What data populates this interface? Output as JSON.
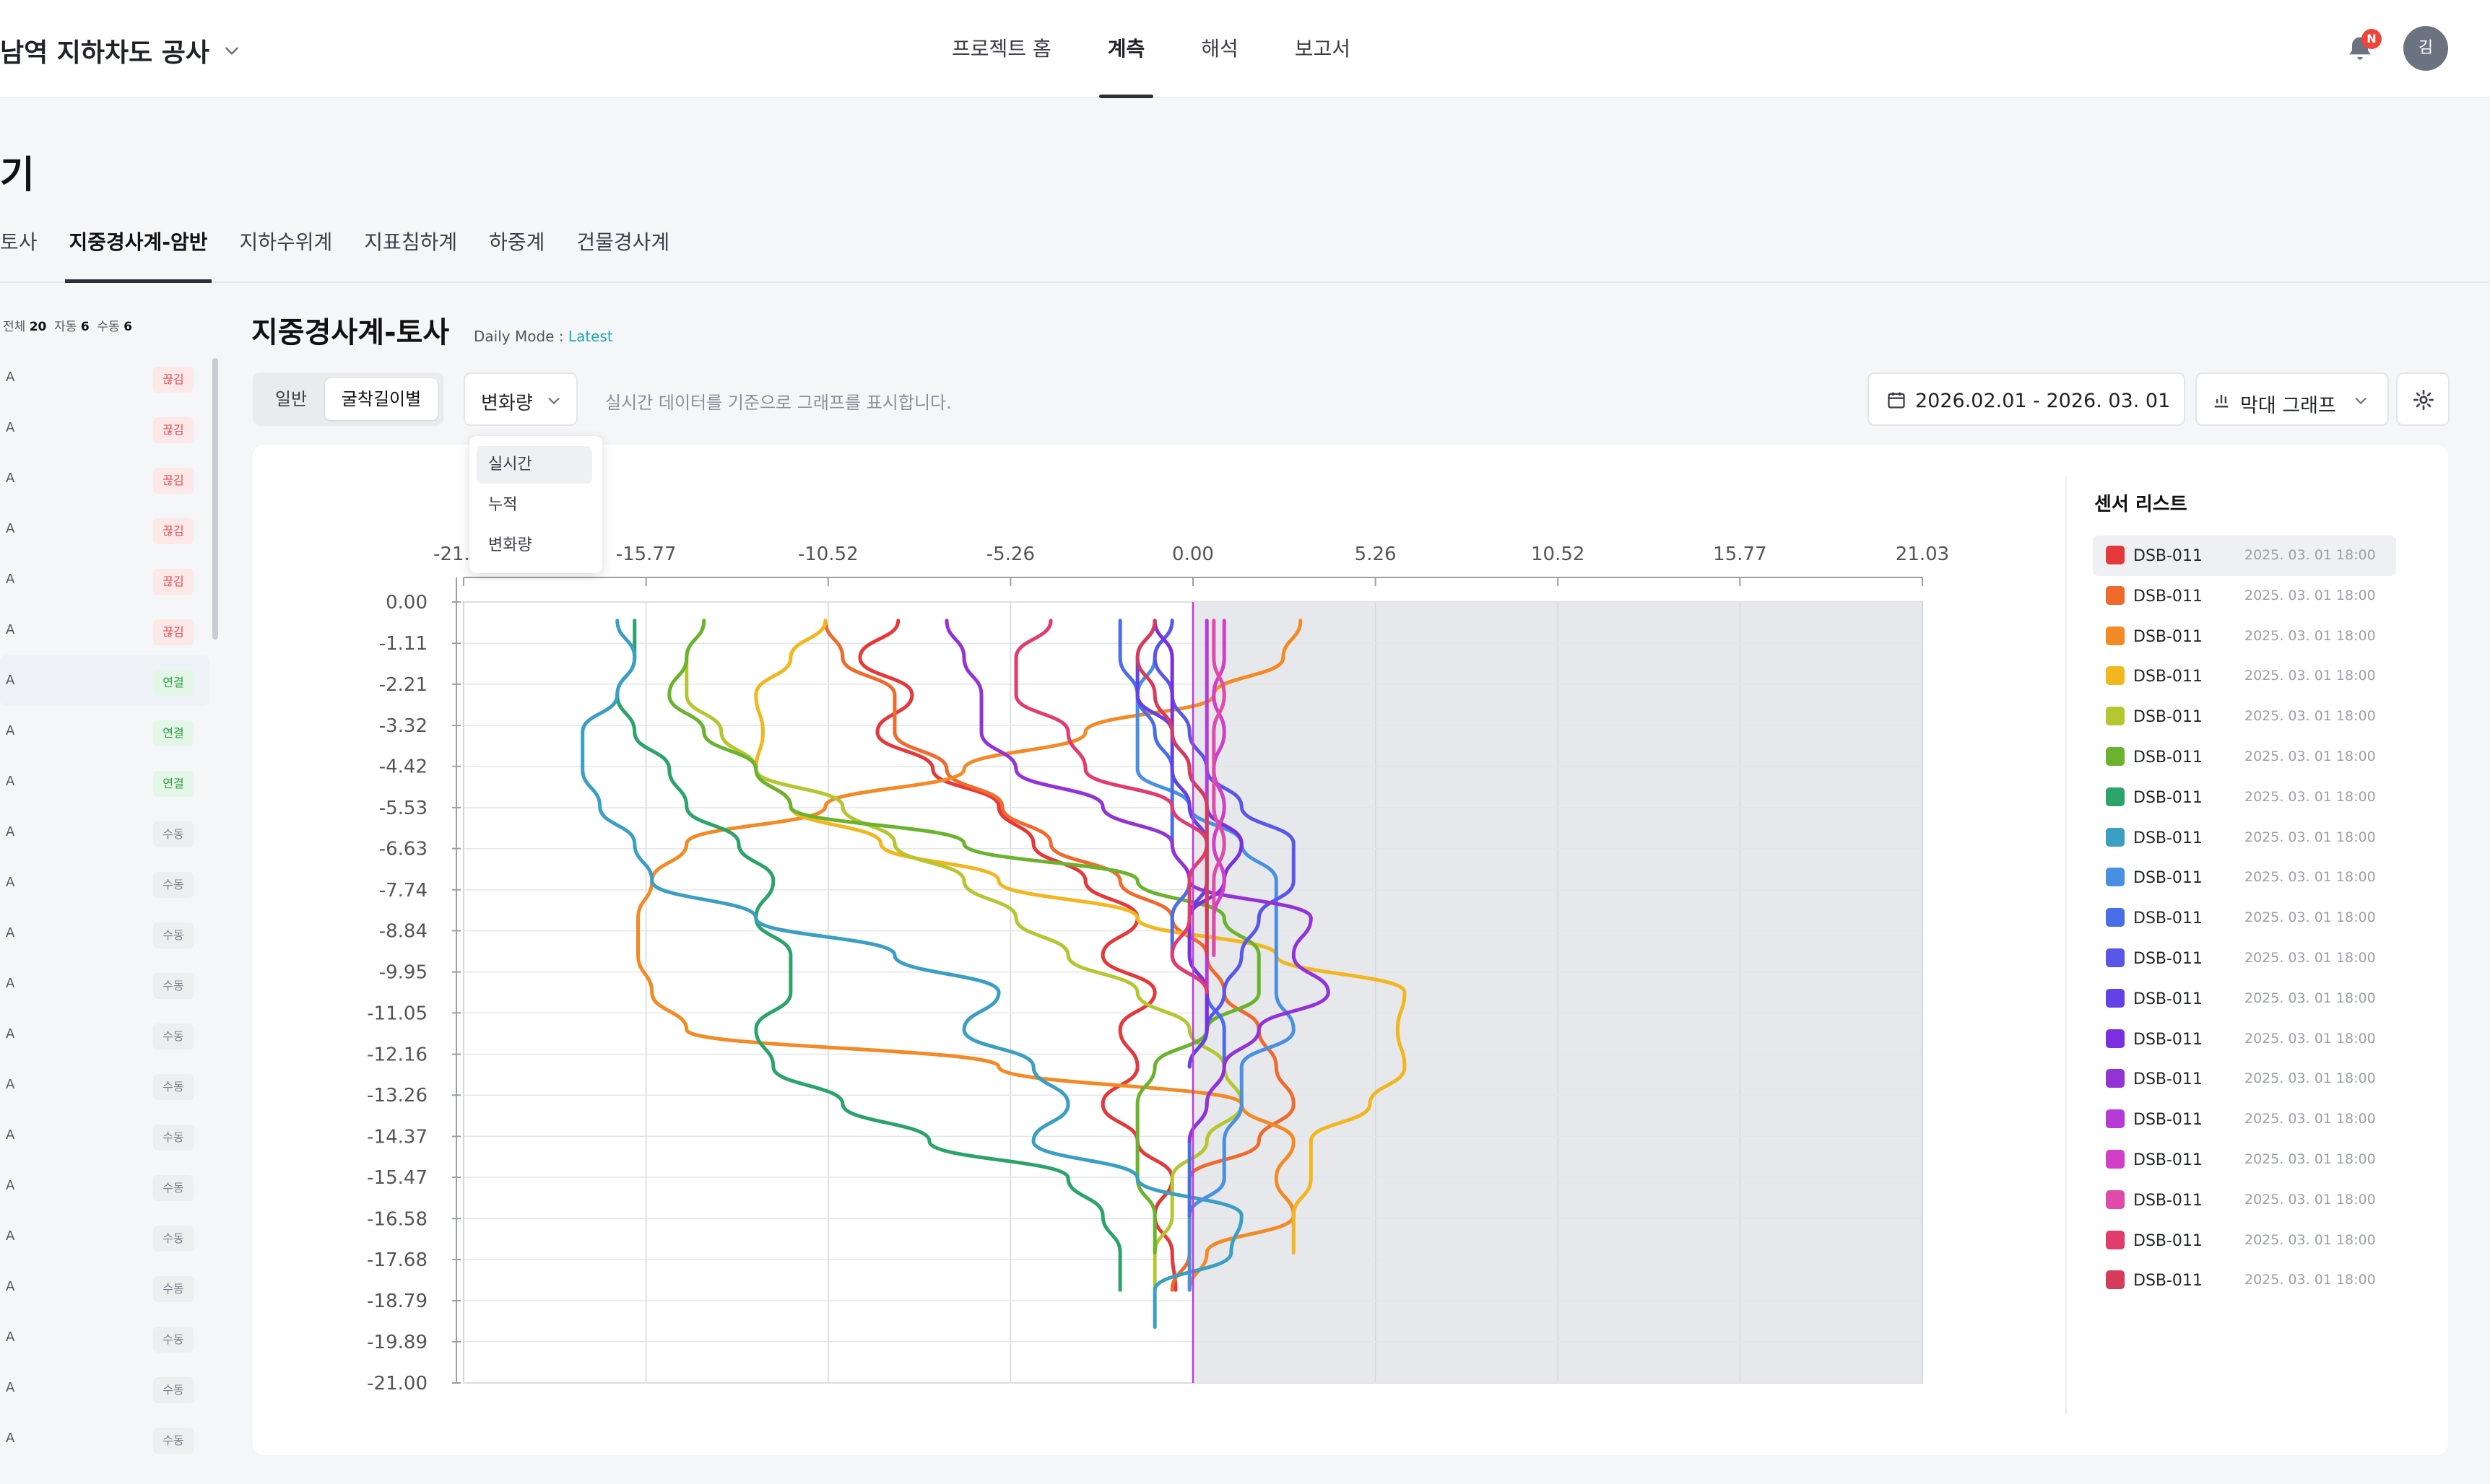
{
  "project": {
    "title": "남역 지하차도 공사"
  },
  "nav": {
    "tabs": [
      "프로젝트 홈",
      "계측",
      "해석",
      "보고서"
    ],
    "active": 1
  },
  "notifications": {
    "badge": "N"
  },
  "user": {
    "initial": "김"
  },
  "page": {
    "title": "기"
  },
  "subtabs": {
    "items": [
      "토사",
      "지중경사계-암반",
      "지하수위계",
      "지표침하계",
      "하중계",
      "건물경사계"
    ],
    "active": 1
  },
  "left_panel": {
    "summary_all_label": "전체",
    "summary_all": "20",
    "summary_auto_label": "자동",
    "summary_auto": "6",
    "summary_manual_label": "수동",
    "summary_manual": "6",
    "rows": [
      {
        "name": "A",
        "badge": "끊김",
        "type": "red"
      },
      {
        "name": "A",
        "badge": "끊김",
        "type": "red"
      },
      {
        "name": "A",
        "badge": "끊김",
        "type": "red"
      },
      {
        "name": "A",
        "badge": "끊김",
        "type": "red"
      },
      {
        "name": "A",
        "badge": "끊김",
        "type": "red"
      },
      {
        "name": "A",
        "badge": "끊김",
        "type": "red"
      },
      {
        "name": "A",
        "badge": "연결",
        "type": "green",
        "highlight": true
      },
      {
        "name": "A",
        "badge": "연결",
        "type": "green"
      },
      {
        "name": "A",
        "badge": "연결",
        "type": "green"
      },
      {
        "name": "A",
        "badge": "수동",
        "type": "gray"
      },
      {
        "name": "A",
        "badge": "수동",
        "type": "gray"
      },
      {
        "name": "A",
        "badge": "수동",
        "type": "gray"
      },
      {
        "name": "A",
        "badge": "수동",
        "type": "gray"
      },
      {
        "name": "A",
        "badge": "수동",
        "type": "gray"
      },
      {
        "name": "A",
        "badge": "수동",
        "type": "gray"
      },
      {
        "name": "A",
        "badge": "수동",
        "type": "gray"
      },
      {
        "name": "A",
        "badge": "수동",
        "type": "gray"
      },
      {
        "name": "A",
        "badge": "수동",
        "type": "gray"
      },
      {
        "name": "A",
        "badge": "수동",
        "type": "gray"
      },
      {
        "name": "A",
        "badge": "수동",
        "type": "gray"
      },
      {
        "name": "A",
        "badge": "수동",
        "type": "gray"
      },
      {
        "name": "A",
        "badge": "수동",
        "type": "gray"
      }
    ]
  },
  "section": {
    "title": "지중경사계-토사",
    "daily_label": "Daily Mode :",
    "daily_value": "Latest"
  },
  "toolbar": {
    "seg_general": "일반",
    "seg_depth": "굴착길이별",
    "metric_selected": "변화량",
    "hint": "실시간 데이터를 기준으로 그래프를 표시합니다.",
    "metric_options": [
      "실시간",
      "누적",
      "변화량"
    ],
    "date_range": "2026.02.01 - 2026. 03. 01",
    "chart_type": "막대 그래프"
  },
  "sensor_panel": {
    "title": "센서 리스트",
    "sensors": [
      {
        "name": "DSB-011",
        "time": "2025. 03. 01 18:00",
        "color": "#e5383b"
      },
      {
        "name": "DSB-011",
        "time": "2025. 03. 01 18:00",
        "color": "#f06a2e"
      },
      {
        "name": "DSB-011",
        "time": "2025. 03. 01 18:00",
        "color": "#f28a25"
      },
      {
        "name": "DSB-011",
        "time": "2025. 03. 01 18:00",
        "color": "#f2b61f"
      },
      {
        "name": "DSB-011",
        "time": "2025. 03. 01 18:00",
        "color": "#b5c631"
      },
      {
        "name": "DSB-011",
        "time": "2025. 03. 01 18:00",
        "color": "#6bb32e"
      },
      {
        "name": "DSB-011",
        "time": "2025. 03. 01 18:00",
        "color": "#2ba36a"
      },
      {
        "name": "DSB-011",
        "time": "2025. 03. 01 18:00",
        "color": "#3a9fc2"
      },
      {
        "name": "DSB-011",
        "time": "2025. 03. 01 18:00",
        "color": "#4a90e2"
      },
      {
        "name": "DSB-011",
        "time": "2025. 03. 01 18:00",
        "color": "#4a6ee8"
      },
      {
        "name": "DSB-011",
        "time": "2025. 03. 01 18:00",
        "color": "#5a57e8"
      },
      {
        "name": "DSB-011",
        "time": "2025. 03. 01 18:00",
        "color": "#6242e6"
      },
      {
        "name": "DSB-011",
        "time": "2025. 03. 01 18:00",
        "color": "#7b2fe0"
      },
      {
        "name": "DSB-011",
        "time": "2025. 03. 01 18:00",
        "color": "#9333d6"
      },
      {
        "name": "DSB-011",
        "time": "2025. 03. 01 18:00",
        "color": "#b63bd6"
      },
      {
        "name": "DSB-011",
        "time": "2025. 03. 01 18:00",
        "color": "#d23ec8"
      },
      {
        "name": "DSB-011",
        "time": "2025. 03. 01 18:00",
        "color": "#e04aa8"
      },
      {
        "name": "DSB-011",
        "time": "2025. 03. 01 18:00",
        "color": "#e23b6e"
      },
      {
        "name": "DSB-011",
        "time": "2025. 03. 01 18:00",
        "color": "#d63b5c"
      }
    ]
  },
  "chart_data": {
    "type": "line",
    "x_ticks": [
      "-21.03",
      "-15.77",
      "-10.52",
      "-5.26",
      "0.00",
      "5.26",
      "10.52",
      "15.77",
      "21.03"
    ],
    "y_ticks": [
      "0.00",
      "-1.11",
      "-2.21",
      "-3.32",
      "-4.42",
      "-5.53",
      "-6.63",
      "-7.74",
      "-8.84",
      "-9.95",
      "-11.05",
      "-12.16",
      "-13.26",
      "-14.37",
      "-15.47",
      "-16.58",
      "-17.68",
      "-18.79",
      "-19.89",
      "-21.00"
    ],
    "xlim": [
      -21.03,
      21.03
    ],
    "ylim": [
      -21.0,
      0.0
    ],
    "depth": [
      -0.5,
      -1.5,
      -2.5,
      -3.5,
      -4.5,
      -5.5,
      -6.5,
      -7.5,
      -8.5,
      -9.5,
      -10.5,
      -11.5,
      -12.5,
      -13.5,
      -14.5,
      -15.5,
      -16.5,
      -17.5,
      -18.5,
      -19.5,
      -20.5
    ],
    "series": [
      {
        "color": "#e5383b",
        "values": [
          -8.5,
          -9.6,
          -8.1,
          -9.1,
          -7.5,
          -5.6,
          -4.6,
          -3.1,
          -1.6,
          -2.6,
          -1.1,
          -2.1,
          -1.6,
          -2.6,
          -1.6,
          -0.6,
          -1.1,
          -0.6,
          -0.5,
          null,
          null
        ]
      },
      {
        "color": "#f06a2e",
        "values": [
          -10.6,
          -10.1,
          -8.6,
          -8.6,
          -7.1,
          -5.5,
          -4.1,
          -2.1,
          -0.6,
          0.4,
          0.9,
          1.9,
          2.4,
          2.9,
          1.9,
          -0.1,
          -0.1,
          -0.1,
          -0.6,
          null,
          null
        ]
      },
      {
        "color": "#f28a25",
        "values": [
          3.1,
          2.6,
          0.6,
          -3.1,
          -6.6,
          -10.6,
          -14.6,
          -15.6,
          -16.0,
          -16.0,
          -15.6,
          -14.6,
          -5.6,
          1.4,
          2.9,
          2.4,
          2.9,
          0.4,
          -0.1,
          null,
          null
        ]
      },
      {
        "color": "#f2b61f",
        "values": [
          -10.6,
          -11.6,
          -12.6,
          -12.4,
          -12.6,
          -11.6,
          -9.0,
          -5.6,
          -1.6,
          2.4,
          6.1,
          5.9,
          6.1,
          5.1,
          3.4,
          3.4,
          2.9,
          2.9,
          null,
          null,
          null
        ]
      },
      {
        "color": "#b5c631",
        "values": [
          -14.1,
          -14.6,
          -14.6,
          -13.6,
          -12.6,
          -10.1,
          -8.6,
          -6.6,
          -5.1,
          -3.6,
          -1.6,
          -0.1,
          0.9,
          1.4,
          0.4,
          -0.6,
          -0.6,
          -1.1,
          -1.1,
          null,
          null
        ]
      },
      {
        "color": "#6bb32e",
        "values": [
          -14.1,
          -14.6,
          -15.1,
          -14.1,
          -12.6,
          -11.6,
          -6.6,
          -1.6,
          0.9,
          1.9,
          1.9,
          0.4,
          -1.1,
          -1.6,
          -1.6,
          -1.6,
          -1.1,
          -1.1,
          null,
          null,
          null
        ]
      },
      {
        "color": "#2ba36a",
        "values": [
          -16.1,
          -16.1,
          -16.6,
          -16.1,
          -15.1,
          -14.6,
          -13.1,
          -12.1,
          -12.6,
          -11.6,
          -11.6,
          -12.6,
          -12.1,
          -10.1,
          -7.6,
          -3.6,
          -2.6,
          -2.1,
          -2.1,
          null,
          null
        ]
      },
      {
        "color": "#3a9fc2",
        "values": [
          -16.6,
          -16.1,
          -16.6,
          -17.6,
          -17.6,
          -17.1,
          -16.1,
          -15.6,
          -12.6,
          -8.6,
          -5.6,
          -6.6,
          -4.6,
          -3.6,
          -4.6,
          -1.6,
          1.4,
          1.1,
          -1.1,
          -1.1,
          null
        ]
      },
      {
        "color": "#4a90e2",
        "values": [
          -0.6,
          -1.1,
          -1.6,
          -1.6,
          -1.6,
          -0.1,
          1.4,
          2.4,
          2.4,
          2.4,
          2.4,
          2.9,
          1.4,
          1.4,
          0.9,
          0.9,
          -0.1,
          -0.1,
          -0.1,
          null,
          null
        ]
      },
      {
        "color": "#4a6ee8",
        "values": [
          -2.1,
          -2.1,
          -1.6,
          -1.1,
          -0.6,
          -0.6,
          -0.6,
          -0.1,
          -0.6,
          -0.6,
          0.4,
          0.9,
          0.9,
          0.4,
          -0.1,
          -0.1,
          -0.1,
          null,
          null,
          null,
          null
        ]
      },
      {
        "color": "#5a57e8",
        "values": [
          -0.6,
          -1.1,
          -0.6,
          -0.1,
          0.4,
          1.4,
          2.9,
          2.9,
          1.9,
          1.4,
          0.9,
          0.4,
          -0.1,
          null,
          null,
          null,
          null,
          null,
          null,
          null,
          null
        ]
      },
      {
        "color": "#6242e6",
        "values": [
          -1.1,
          -1.6,
          -1.6,
          -0.6,
          -0.6,
          -0.1,
          0.4,
          0.4,
          -0.1,
          -0.1,
          0.4,
          0.4,
          -0.1,
          null,
          null,
          null,
          null,
          null,
          null,
          null,
          null
        ]
      },
      {
        "color": "#7b2fe0",
        "values": [
          -1.1,
          -0.6,
          -0.6,
          -0.6,
          -0.1,
          0.4,
          1.4,
          0.9,
          -0.1,
          -0.1,
          0.4,
          0.4,
          null,
          null,
          null,
          null,
          null,
          null,
          null,
          null,
          null
        ]
      },
      {
        "color": "#9333d6",
        "values": [
          -7.1,
          -6.6,
          -6.1,
          -6.1,
          -5.1,
          -2.6,
          -0.6,
          -0.1,
          3.4,
          2.9,
          3.9,
          1.9,
          0.9,
          0.4,
          -0.1,
          null,
          null,
          null,
          null,
          null,
          null
        ]
      },
      {
        "color": "#b63bd6",
        "values": [
          0.4,
          0.4,
          0.4,
          0.4,
          0.4,
          0.4,
          0.4,
          0.4,
          0.4,
          0.4,
          0.4,
          null,
          null,
          null,
          null,
          null,
          null,
          null,
          null,
          null,
          null
        ]
      },
      {
        "color": "#d23ec8",
        "values": [
          0.9,
          0.9,
          0.6,
          0.9,
          0.6,
          0.9,
          0.6,
          0.9,
          0.6,
          0.6,
          null,
          null,
          null,
          null,
          null,
          null,
          null,
          null,
          null,
          null,
          null
        ]
      },
      {
        "color": "#e04aa8",
        "values": [
          0.6,
          0.6,
          0.9,
          0.6,
          0.6,
          0.6,
          0.9,
          0.6,
          0.6,
          0.6,
          null,
          null,
          null,
          null,
          null,
          null,
          null,
          null,
          null,
          null,
          null
        ]
      },
      {
        "color": "#e23b6e",
        "values": [
          -4.1,
          -5.1,
          -5.1,
          -3.6,
          -3.1,
          -0.6,
          0.4,
          -0.1,
          -0.1,
          -0.6,
          0.4,
          null,
          null,
          null,
          null,
          null,
          null,
          null,
          null,
          null,
          null
        ]
      },
      {
        "color": "#d63b5c",
        "values": [
          -1.1,
          -1.6,
          -1.1,
          -0.6,
          -0.1,
          0.4,
          0.4,
          0.4,
          0.4,
          0.4,
          null,
          null,
          null,
          null,
          null,
          null,
          null,
          null,
          null,
          null,
          null
        ]
      }
    ]
  }
}
